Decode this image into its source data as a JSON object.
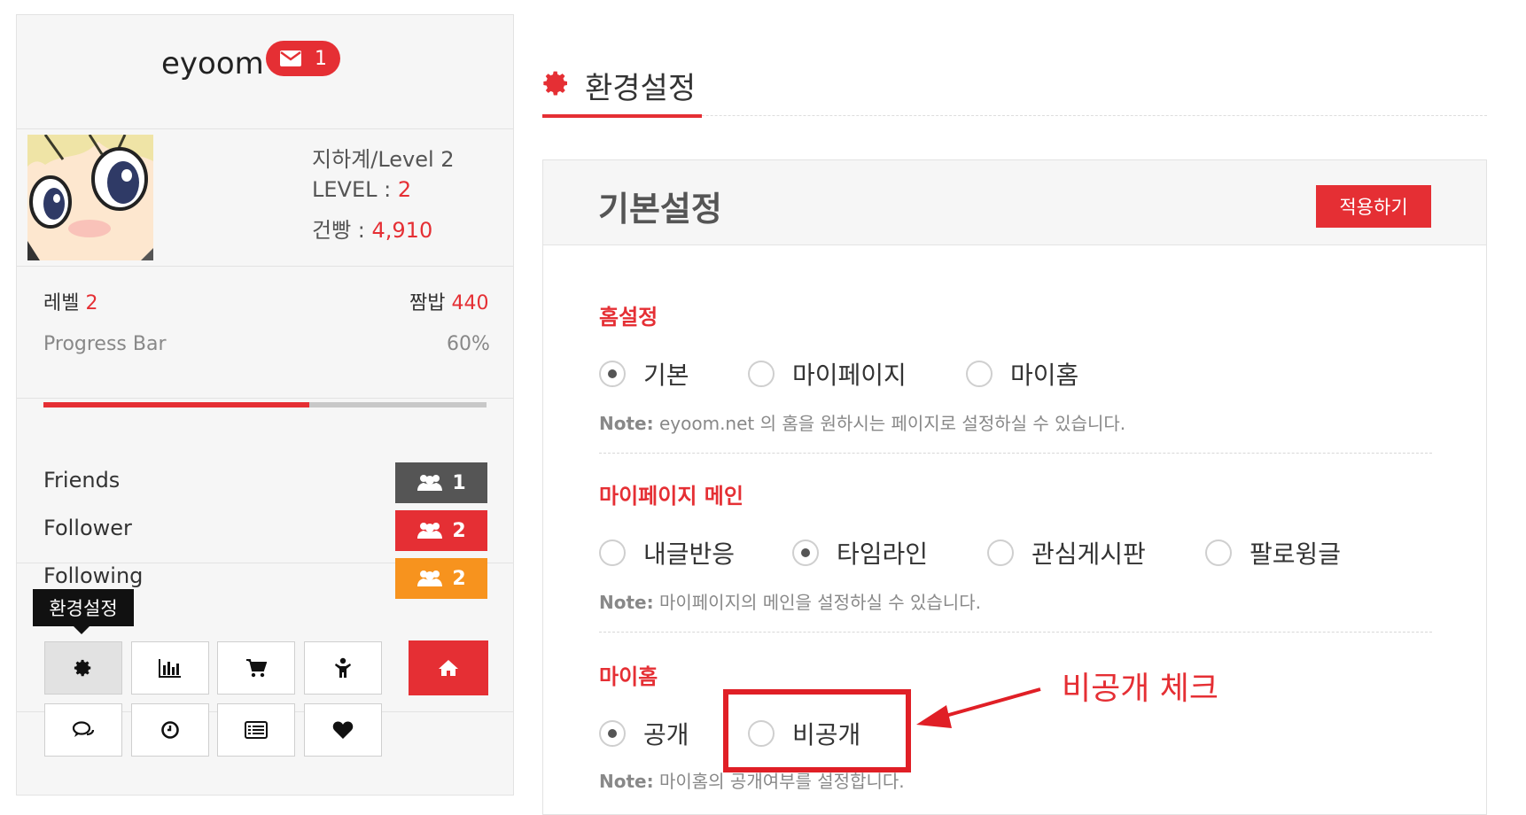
{
  "sidebar": {
    "username": "eyoom",
    "message_count": "1",
    "rank": "지하계/Level 2",
    "level_label": "LEVEL : ",
    "level_value": "2",
    "points_label": "건빵 : ",
    "points_value": "4,910",
    "level_row_label": "레벨",
    "level_row_value": "2",
    "rice_label": "짬밥",
    "rice_value": "440",
    "progress_label": "Progress Bar",
    "progress_text": "60%",
    "progress_value": 60,
    "friends_label": "Friends",
    "friends_count": "1",
    "follower_label": "Follower",
    "follower_count": "2",
    "following_label": "Following",
    "following_count": "2",
    "tooltip": "환경설정",
    "colors": {
      "accent": "#e52f34",
      "friends": "#555555",
      "following": "#f7931e"
    }
  },
  "main": {
    "title": "환경설정",
    "card_title": "기본설정",
    "apply_label": "적용하기",
    "sections": [
      {
        "title": "홈설정",
        "options": [
          "기본",
          "마이페이지",
          "마이홈"
        ],
        "selected": 0,
        "note_prefix": "Note:",
        "note": " eyoom.net 의 홈을 원하시는 페이지로 설정하실 수 있습니다."
      },
      {
        "title": "마이페이지 메인",
        "options": [
          "내글반응",
          "타임라인",
          "관심게시판",
          "팔로윙글"
        ],
        "selected": 1,
        "note_prefix": "Note:",
        "note": " 마이페이지의 메인을 설정하실 수 있습니다."
      },
      {
        "title": "마이홈",
        "options": [
          "공개",
          "비공개"
        ],
        "selected": 0,
        "note_prefix": "Note:",
        "note": " 마이홈의 공개여부를 설정합니다."
      }
    ],
    "annotation": "비공개 체크"
  }
}
